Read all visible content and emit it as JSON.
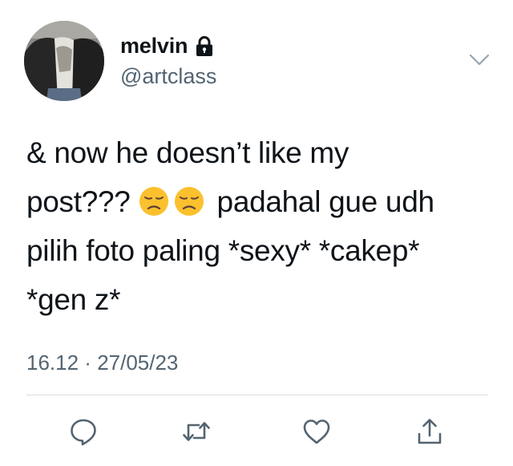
{
  "user": {
    "display_name": "melvin",
    "handle": "@artclass",
    "protected_icon": "lock-icon"
  },
  "tweet": {
    "line1": "& now he doesn’t like my",
    "line2_before_emoji": "post??? ",
    "line2_after_emoji": "padahal gue udh",
    "line3": "pilih foto paling *sexy* *cakep*",
    "line4": "*gen z*",
    "emojis": [
      "disappointed-face-emoji",
      "disappointed-face-emoji"
    ],
    "time": "16.12",
    "separator": " · ",
    "date": "27/05/23"
  },
  "actions": {
    "icons": [
      "reply-icon",
      "retweet-icon",
      "like-icon",
      "share-icon"
    ]
  },
  "colors": {
    "text": "#0f1419",
    "secondary": "#536471",
    "icon": "#536471",
    "divider": "#d8dde1",
    "emoji_face": "#fbc02d"
  }
}
